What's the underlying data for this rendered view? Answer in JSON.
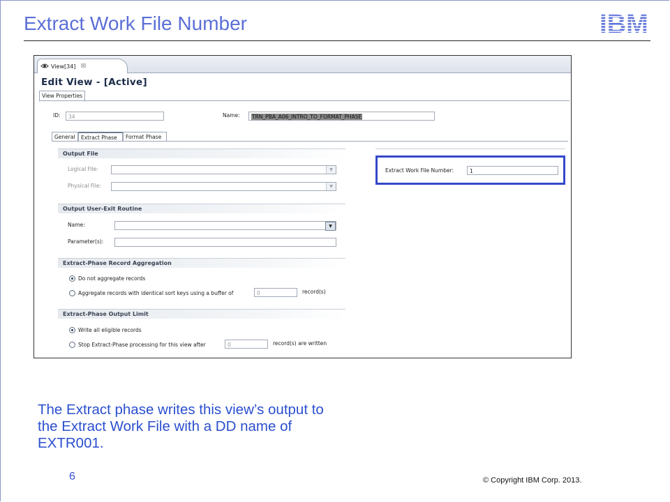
{
  "slide": {
    "title": "Extract Work File Number",
    "caption_lines": [
      "The Extract phase writes this view’s output to",
      "the Extract Work File with a DD name of",
      "EXTR001."
    ],
    "page_number": "6",
    "copyright": "© Copyright  IBM Corp.  2013.",
    "logo_text": "IBM",
    "accent_color": "#5b6fd6"
  },
  "editor": {
    "tab_label": "View[34]",
    "tab_close": "☒",
    "header": "Edit View - [Active]",
    "properties_tab": "View Properties",
    "id_label": "ID:",
    "id_value": "34",
    "name_label": "Name:",
    "name_value": "TRN_PBA_A06_INTRO_TO_FORMAT_PHASE",
    "subtabs": [
      "General",
      "Extract Phase",
      "Format Phase"
    ],
    "active_subtab": "Extract Phase"
  },
  "output_file": {
    "title": "Output File",
    "logical_label": "Logical File:",
    "physical_label": "Physical File:",
    "logical_value": "",
    "physical_value": ""
  },
  "user_exit": {
    "title": "Output User-Exit Routine",
    "name_label": "Name:",
    "params_label": "Parameter(s):",
    "name_value": "",
    "params_value": ""
  },
  "aggregation": {
    "title": "Extract-Phase Record Aggregation",
    "option1": "Do not aggregate records",
    "option2": "Aggregate records with identical sort keys using a buffer of",
    "buffer_value": "0",
    "suffix": "record(s)",
    "selected": 1
  },
  "output_limit": {
    "title": "Extract-Phase Output Limit",
    "option1": "Write all eligible records",
    "option2": "Stop Extract-Phase processing for this view after",
    "limit_value": "0",
    "suffix": "record(s) are written",
    "selected": 1
  },
  "work_file": {
    "label": "Extract Work File Number:",
    "value": "1",
    "highlight_color": "#3548c8"
  }
}
